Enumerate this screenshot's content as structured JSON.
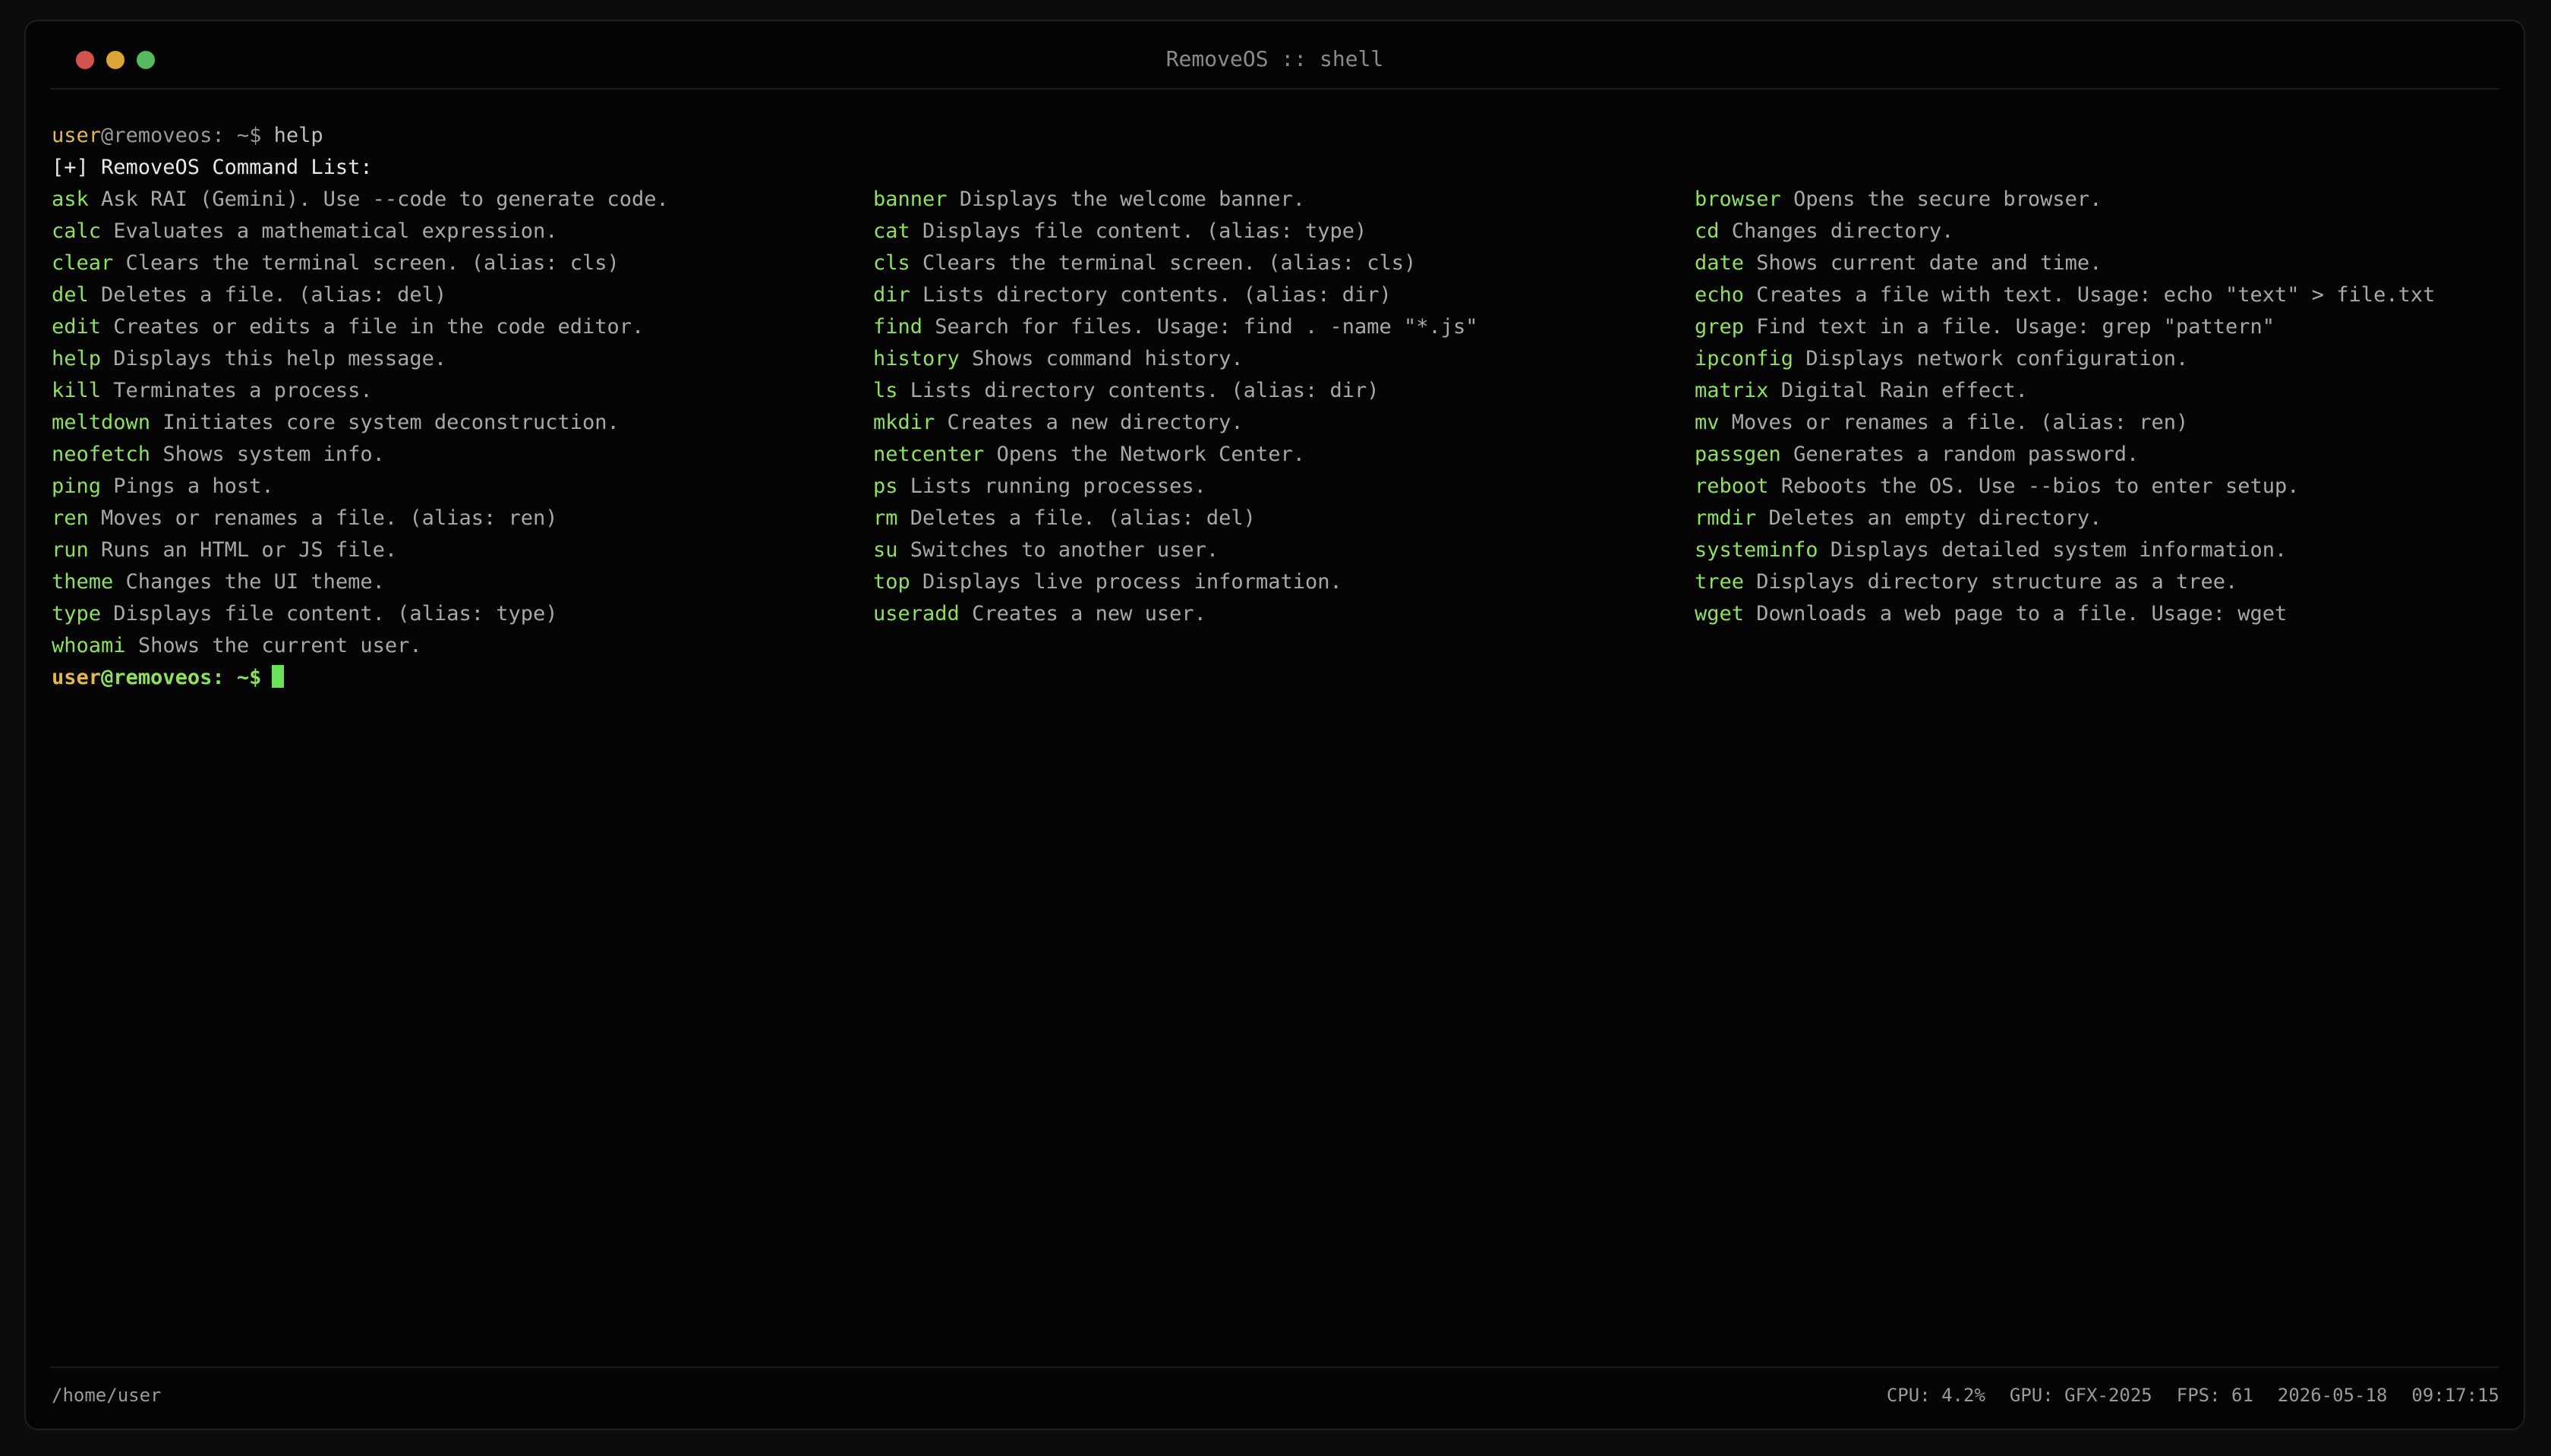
{
  "window": {
    "title": "RemoveOS :: shell"
  },
  "terminal": {
    "prompt1": {
      "user": "user",
      "host": "@removeos: ~$ ",
      "command": "help"
    },
    "header": "[+] RemoveOS Command List:",
    "columns": [
      [
        {
          "cmd": "ask",
          "desc": "Ask RAI (Gemini). Use --code to generate code."
        },
        {
          "cmd": "calc",
          "desc": "Evaluates a mathematical expression."
        },
        {
          "cmd": "clear",
          "desc": "Clears the terminal screen. (alias: cls)"
        },
        {
          "cmd": "del",
          "desc": "Deletes a file. (alias: del)"
        },
        {
          "cmd": "edit",
          "desc": "Creates or edits a file in the code editor."
        },
        {
          "cmd": "help",
          "desc": "Displays this help message."
        },
        {
          "cmd": "kill",
          "desc": "Terminates a process."
        },
        {
          "cmd": "meltdown",
          "desc": "Initiates core system deconstruction."
        },
        {
          "cmd": "neofetch",
          "desc": "Shows system info."
        },
        {
          "cmd": "ping",
          "desc": "Pings a host."
        },
        {
          "cmd": "ren",
          "desc": "Moves or renames a file. (alias: ren)"
        },
        {
          "cmd": "run",
          "desc": "Runs an HTML or JS file."
        },
        {
          "cmd": "theme",
          "desc": "Changes the UI theme."
        },
        {
          "cmd": "type",
          "desc": "Displays file content. (alias: type)"
        },
        {
          "cmd": "whoami",
          "desc": "Shows the current user."
        }
      ],
      [
        {
          "cmd": "banner",
          "desc": "Displays the welcome banner."
        },
        {
          "cmd": "cat",
          "desc": "Displays file content. (alias: type)"
        },
        {
          "cmd": "cls",
          "desc": "Clears the terminal screen. (alias: cls)"
        },
        {
          "cmd": "dir",
          "desc": "Lists directory contents. (alias: dir)"
        },
        {
          "cmd": "find",
          "desc": "Search for files. Usage: find . -name \"*.js\""
        },
        {
          "cmd": "history",
          "desc": "Shows command history."
        },
        {
          "cmd": "ls",
          "desc": "Lists directory contents. (alias: dir)"
        },
        {
          "cmd": "mkdir",
          "desc": "Creates a new directory."
        },
        {
          "cmd": "netcenter",
          "desc": "Opens the Network Center."
        },
        {
          "cmd": "ps",
          "desc": "Lists running processes."
        },
        {
          "cmd": "rm",
          "desc": "Deletes a file. (alias: del)"
        },
        {
          "cmd": "su",
          "desc": "Switches to another user."
        },
        {
          "cmd": "top",
          "desc": "Displays live process information."
        },
        {
          "cmd": "useradd",
          "desc": "Creates a new user."
        }
      ],
      [
        {
          "cmd": "browser",
          "desc": "Opens the secure browser."
        },
        {
          "cmd": "cd",
          "desc": "Changes directory."
        },
        {
          "cmd": "date",
          "desc": "Shows current date and time."
        },
        {
          "cmd": "echo",
          "desc": "Creates a file with text. Usage: echo \"text\" > file.txt"
        },
        {
          "cmd": "grep",
          "desc": "Find text in a file. Usage: grep \"pattern\""
        },
        {
          "cmd": "ipconfig",
          "desc": "Displays network configuration."
        },
        {
          "cmd": "matrix",
          "desc": "Digital Rain effect."
        },
        {
          "cmd": "mv",
          "desc": "Moves or renames a file. (alias: ren)"
        },
        {
          "cmd": "passgen",
          "desc": "Generates a random password."
        },
        {
          "cmd": "reboot",
          "desc": "Reboots the OS. Use --bios to enter setup."
        },
        {
          "cmd": "rmdir",
          "desc": "Deletes an empty directory."
        },
        {
          "cmd": "systeminfo",
          "desc": "Displays detailed system information."
        },
        {
          "cmd": "tree",
          "desc": "Displays directory structure as a tree."
        },
        {
          "cmd": "wget",
          "desc": "Downloads a web page to a file. Usage: wget"
        }
      ]
    ],
    "prompt2": {
      "user": "user",
      "host": "@removeos: ~$"
    }
  },
  "statusbar": {
    "cwd": "/home/user",
    "cpu": "CPU: 4.2%",
    "gpu": "GPU: GFX-2025",
    "fps": "FPS: 61",
    "date": "2026-05-18",
    "time": "09:17:15"
  },
  "colors": {
    "command": "#8fe05d",
    "user": "#e4b84a",
    "cursor": "#6be25a",
    "background": "#050505"
  }
}
